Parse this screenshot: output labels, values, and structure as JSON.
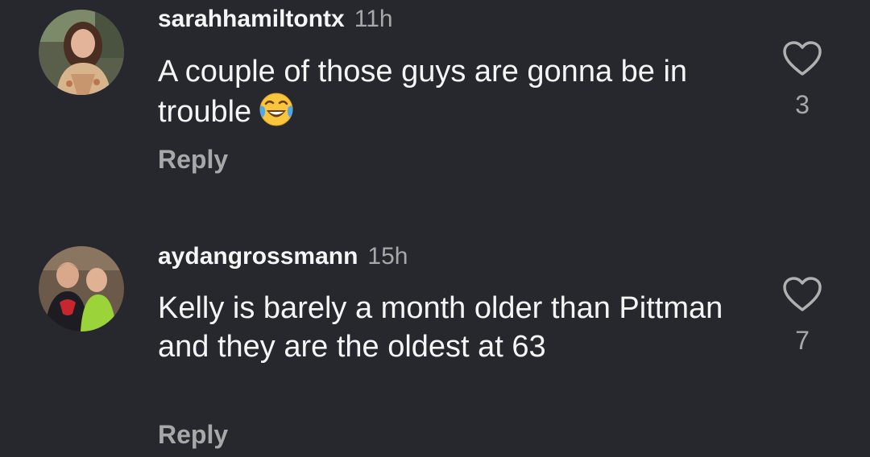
{
  "comments": [
    {
      "username": "sarahhamiltontx",
      "time": "11h",
      "text": "A couple of those guys are gonna be in trouble",
      "emoji": "face-with-tears-of-joy-icon",
      "reply_label": "Reply",
      "like_count": "3"
    },
    {
      "username": "aydangrossmann",
      "time": "15h",
      "text": "Kelly is barely a month older than Pittman and they are the oldest at 63",
      "reply_label": "Reply",
      "like_count": "7"
    }
  ],
  "icons": {
    "like": "heart-outline-icon"
  },
  "colors": {
    "background": "#26282d",
    "primary_text": "#f5f5f5",
    "secondary_text": "#a8a8a8"
  }
}
